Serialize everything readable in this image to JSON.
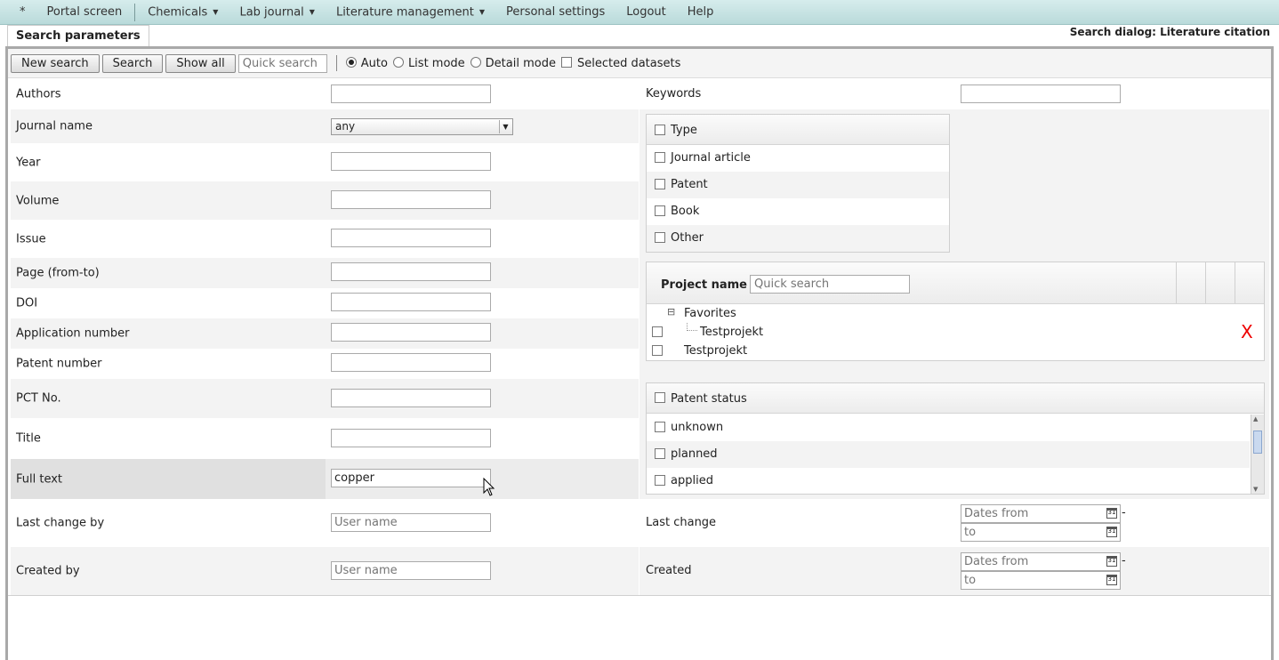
{
  "menu": {
    "items": [
      {
        "label": "*"
      },
      {
        "label": "Portal screen"
      },
      {
        "label": "Chemicals",
        "dropdown": true
      },
      {
        "label": "Lab journal",
        "dropdown": true
      },
      {
        "label": "Literature management",
        "dropdown": true
      },
      {
        "label": "Personal settings"
      },
      {
        "label": "Logout"
      },
      {
        "label": "Help"
      }
    ]
  },
  "tab": {
    "label": "Search parameters"
  },
  "dialog_title": "Search dialog: Literature citation",
  "toolbar": {
    "new_search": "New search",
    "search": "Search",
    "show_all": "Show all",
    "quick_search_placeholder": "Quick search",
    "modes": {
      "auto": "Auto",
      "list": "List mode",
      "detail": "Detail mode",
      "selected": "Selected datasets"
    },
    "selected_mode": "Auto"
  },
  "fields": {
    "authors": {
      "label": "Authors",
      "value": ""
    },
    "journal_name": {
      "label": "Journal name",
      "value": "any"
    },
    "year": {
      "label": "Year",
      "value": ""
    },
    "volume": {
      "label": "Volume",
      "value": ""
    },
    "issue": {
      "label": "Issue",
      "value": ""
    },
    "page": {
      "label": "Page (from-to)",
      "value": ""
    },
    "doi": {
      "label": "DOI",
      "value": ""
    },
    "application_number": {
      "label": "Application number",
      "value": ""
    },
    "patent_number": {
      "label": "Patent number",
      "value": ""
    },
    "pct_no": {
      "label": "PCT No.",
      "value": ""
    },
    "title": {
      "label": "Title",
      "value": ""
    },
    "full_text": {
      "label": "Full text",
      "value": "copper"
    },
    "last_change_by": {
      "label": "Last change by",
      "placeholder": "User name"
    },
    "created_by": {
      "label": "Created by",
      "placeholder": "User name"
    },
    "keywords": {
      "label": "Keywords",
      "value": ""
    },
    "last_change": {
      "label": "Last change",
      "from_placeholder": "Dates from",
      "to_placeholder": "to",
      "dash": "-"
    },
    "created": {
      "label": "Created",
      "from_placeholder": "Dates from",
      "to_placeholder": "to",
      "dash": "-"
    }
  },
  "type_panel": {
    "header": "Type",
    "items": [
      "Journal article",
      "Patent",
      "Book",
      "Other"
    ]
  },
  "project_panel": {
    "header": "Project name",
    "search_placeholder": "Quick search",
    "tree": {
      "group": "Favorites",
      "group_toggle": "⊟",
      "child": "Testprojekt",
      "root_item": "Testprojekt"
    },
    "remove_label": "X"
  },
  "patent_status_panel": {
    "header": "Patent status",
    "items": [
      "unknown",
      "planned",
      "applied"
    ]
  },
  "calendar_icon_text": "31"
}
